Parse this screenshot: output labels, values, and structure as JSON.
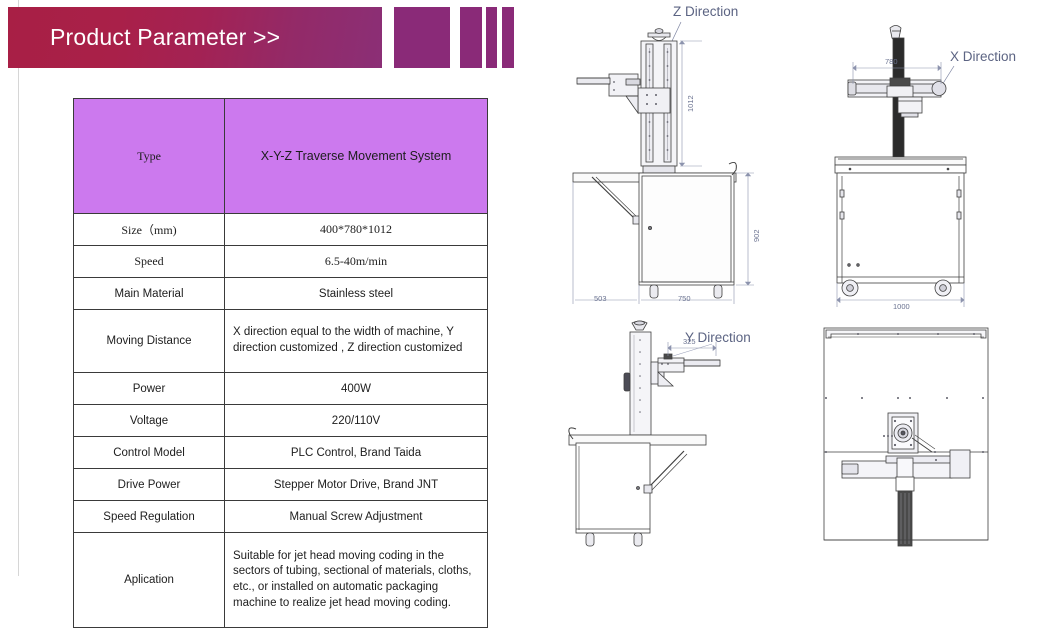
{
  "banner": {
    "title": "Product Parameter >>",
    "gradient_start": "#a81f45",
    "gradient_end": "#8b2f76",
    "deco_color": "#8a2a78"
  },
  "table": {
    "header_bg": "#cc79ee",
    "rows": [
      {
        "label": "Type",
        "value": "X-Y-Z Traverse Movement System"
      },
      {
        "label": "Size（mm)",
        "value": "400*780*1012"
      },
      {
        "label": "Speed",
        "value": "6.5-40m/min"
      },
      {
        "label": "Main Material",
        "value": "Stainless steel"
      },
      {
        "label": "Moving Distance",
        "value": "X direction equal to the width of machine, Y direction customized , Z direction customized"
      },
      {
        "label": "Power",
        "value": "400W"
      },
      {
        "label": "Voltage",
        "value": "220/110V"
      },
      {
        "label": "Control Model",
        "value": "PLC Control, Brand Taida"
      },
      {
        "label": "Drive Power",
        "value": "Stepper Motor Drive, Brand JNT"
      },
      {
        "label": "Speed Regulation",
        "value": "Manual Screw Adjustment"
      },
      {
        "label": "Aplication",
        "value": "Suitable for jet head moving coding in the sectors of tubing, sectional of materials, cloths, etc., or installed on automatic packaging machine to realize jet head moving coding."
      }
    ]
  },
  "drawings": {
    "label_color": "#5c6483",
    "z_view": {
      "title": "Z Direction",
      "dim_height": "1012",
      "dim_cabinet_height": "902",
      "dim_left": "503",
      "dim_width": "750"
    },
    "x_view": {
      "title": "X Direction",
      "dim_travel": "780",
      "dim_width": "1000"
    },
    "y_view": {
      "title": "Y Direction",
      "dim_travel": "325"
    },
    "top_view": {
      "title": ""
    }
  }
}
